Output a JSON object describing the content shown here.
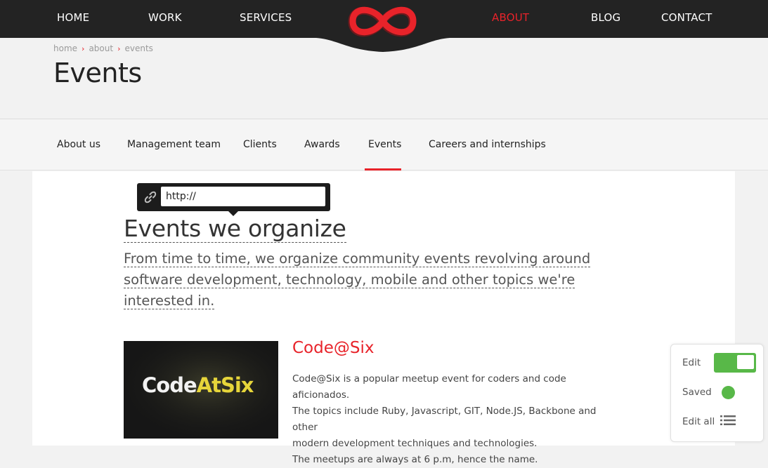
{
  "nav": {
    "items": [
      "HOME",
      "WORK",
      "SERVICES",
      "ABOUT",
      "BLOG",
      "CONTACT"
    ],
    "active": "ABOUT",
    "accent_color": "#e8232a"
  },
  "breadcrumb": [
    "home",
    "about",
    "events"
  ],
  "page_title": "Events",
  "subnav": {
    "items": [
      "About us",
      "Management team",
      "Clients",
      "Awards",
      "Events",
      "Careers and internships"
    ],
    "active": "Events"
  },
  "link_editor": {
    "icon": "link-icon",
    "value": "http://"
  },
  "section": {
    "heading": "Events we organize",
    "description_lines": [
      "From time to time, we organize community events revolving around",
      "software development, technology, mobile and other topics we're",
      "interested in."
    ]
  },
  "event": {
    "title": "Code@Six",
    "image_text_a": "Code",
    "image_text_b": "AtSix",
    "description_lines": [
      "Code@Six is a popular meetup event for coders and code aficionados.",
      "The topics include Ruby, Javascript, GIT, Node.JS, Backbone and other",
      "modern development techniques and technologies.",
      "The meetups are always at 6 p.m, hence the name."
    ]
  },
  "edit_panel": {
    "edit_label": "Edit",
    "saved_label": "Saved",
    "edit_all_label": "Edit all",
    "toggle_on": true,
    "status_color": "#58b848",
    "edit_all_icon": "list-icon"
  }
}
